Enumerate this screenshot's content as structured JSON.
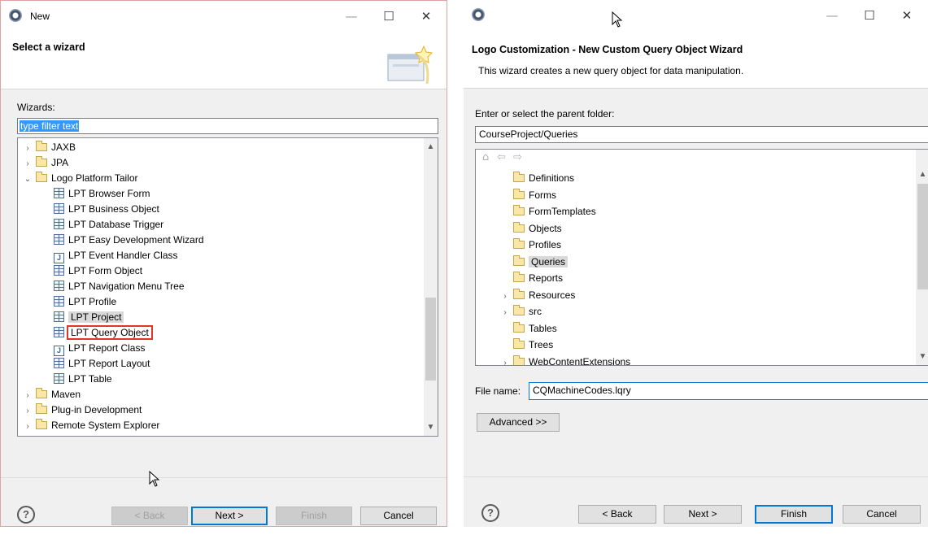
{
  "win1": {
    "title": "New",
    "controls": {
      "minimize": "—",
      "maximize": "☐",
      "close": "✕"
    },
    "header_title": "Select a wizard",
    "wizards_label": "Wizards:",
    "filter_text": "type filter text",
    "tree": [
      {
        "label": "JAXB",
        "kind": "folder",
        "twisty": "›",
        "indent": 0
      },
      {
        "label": "JPA",
        "kind": "folder",
        "twisty": "›",
        "indent": 0
      },
      {
        "label": "Logo Platform Tailor",
        "kind": "folder",
        "twisty": "⌄",
        "indent": 0
      },
      {
        "label": "LPT Browser Form",
        "kind": "item",
        "indent": 1
      },
      {
        "label": "LPT Business Object",
        "kind": "item",
        "indent": 1
      },
      {
        "label": "LPT Database Trigger",
        "kind": "item",
        "indent": 1
      },
      {
        "label": "LPT Easy Development Wizard",
        "kind": "item",
        "indent": 1
      },
      {
        "label": "LPT Event Handler Class",
        "kind": "java",
        "indent": 1
      },
      {
        "label": "LPT Form Object",
        "kind": "item",
        "indent": 1
      },
      {
        "label": "LPT Navigation Menu Tree",
        "kind": "item",
        "indent": 1
      },
      {
        "label": "LPT Profile",
        "kind": "item",
        "indent": 1
      },
      {
        "label": "LPT Project",
        "kind": "item",
        "indent": 1,
        "selected": true
      },
      {
        "label": "LPT Query Object",
        "kind": "item",
        "indent": 1,
        "highlighted": true
      },
      {
        "label": "LPT Report Class",
        "kind": "java",
        "indent": 1
      },
      {
        "label": "LPT Report Layout",
        "kind": "item",
        "indent": 1
      },
      {
        "label": "LPT Table",
        "kind": "item",
        "indent": 1
      },
      {
        "label": "Maven",
        "kind": "folder",
        "twisty": "›",
        "indent": 0
      },
      {
        "label": "Plug-in Development",
        "kind": "folder",
        "twisty": "›",
        "indent": 0
      },
      {
        "label": "Remote System Explorer",
        "kind": "folder",
        "twisty": "›",
        "indent": 0
      }
    ],
    "buttons": {
      "help": "?",
      "back": "< Back",
      "next": "Next >",
      "finish": "Finish",
      "cancel": "Cancel"
    }
  },
  "win2": {
    "controls": {
      "minimize": "—",
      "maximize": "☐",
      "close": "✕"
    },
    "header_title": "Logo Customization - New Custom Query Object Wizard",
    "header_desc": "This wizard creates a new query object for data manipulation.",
    "parent_label": "Enter or select the parent folder:",
    "parent_value": "CourseProject/Queries",
    "nav": {
      "home": "⌂",
      "back": "⇦",
      "forward": "⇨"
    },
    "tree": [
      {
        "label": "Definitions",
        "twisty": ""
      },
      {
        "label": "Forms",
        "twisty": ""
      },
      {
        "label": "FormTemplates",
        "twisty": ""
      },
      {
        "label": "Objects",
        "twisty": ""
      },
      {
        "label": "Profiles",
        "twisty": ""
      },
      {
        "label": "Queries",
        "twisty": "",
        "selected": true
      },
      {
        "label": "Reports",
        "twisty": ""
      },
      {
        "label": "Resources",
        "twisty": "›"
      },
      {
        "label": "src",
        "twisty": "›"
      },
      {
        "label": "Tables",
        "twisty": ""
      },
      {
        "label": "Trees",
        "twisty": ""
      },
      {
        "label": "WebContentExtensions",
        "twisty": "›"
      }
    ],
    "file_label": "File name:",
    "file_value": "CQMachineCodes.lqry",
    "advanced": "Advanced >>",
    "buttons": {
      "help": "?",
      "back": "< Back",
      "next": "Next >",
      "finish": "Finish",
      "cancel": "Cancel"
    }
  }
}
